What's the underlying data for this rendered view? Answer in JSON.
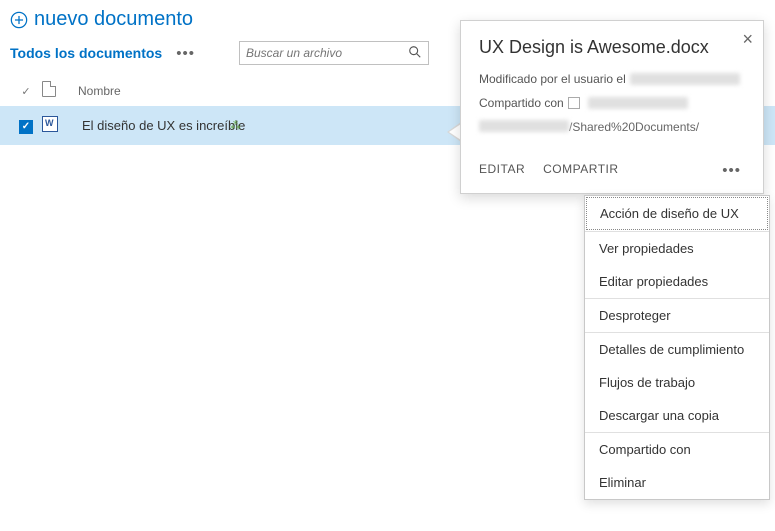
{
  "new_doc_label": "nuevo documento",
  "toolbar": {
    "view_label": "Todos los documentos",
    "search_placeholder": "Buscar un archivo"
  },
  "columns": {
    "name": "Nombre"
  },
  "row": {
    "name": "El diseño de UX es increíble",
    "new_badge": "⁂"
  },
  "callout": {
    "title": "UX Design is Awesome.docx",
    "modified_prefix": "Modificado por el usuario el",
    "shared_prefix": "Compartido con",
    "url_suffix": "/Shared%20Documents/",
    "actions": {
      "edit": "EDITAR",
      "share": "COMPARTIR"
    }
  },
  "menu": {
    "ux_action": "Acción de diseño de UX",
    "view_props": "Ver propiedades",
    "edit_props": "Editar propiedades",
    "checkout": "Desproteger",
    "compliance": "Detalles de cumplimiento",
    "workflows": "Flujos de trabajo",
    "download": "Descargar una copia",
    "shared_with": "Compartido con",
    "delete": "Eliminar"
  }
}
